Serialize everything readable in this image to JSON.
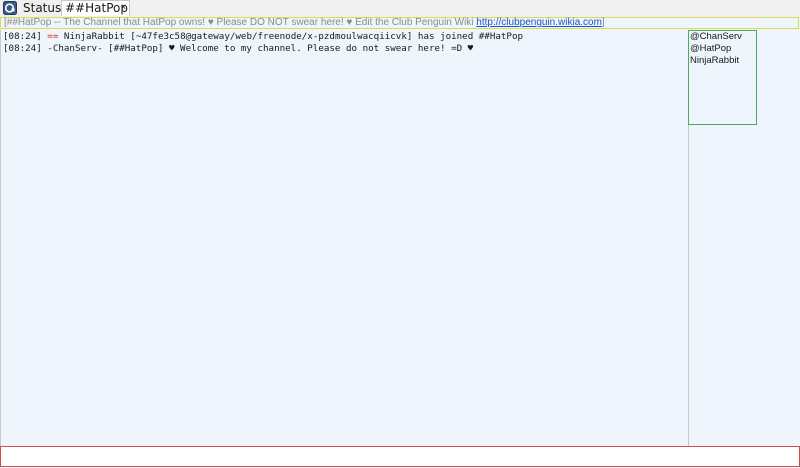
{
  "tabs": {
    "status_label": "Status",
    "channel_label": "##HatPop",
    "close_glyph": "x"
  },
  "topic": {
    "text": "[##HatPop -- The Channel that HatPop owns! ♥ Please DO NOT swear here! ♥ Edit the Club Penguin Wiki ",
    "link": "http://clubpenguin.wikia.com",
    "close_bracket": "]"
  },
  "messages": [
    {
      "time": "[08:24]",
      "marker": "==",
      "text": "NinjaRabbit [~47fe3c58@gateway/web/freenode/x-pzdmoulwacqiicvk] has joined ##HatPop"
    },
    {
      "time": "[08:24]",
      "text": "-ChanServ- [##HatPop] ♥ Welcome to my channel. Please do not swear here! =D ♥"
    }
  ],
  "users": [
    "@ChanServ",
    "@HatPop",
    "NinjaRabbit"
  ],
  "input": {
    "value": "",
    "placeholder": ""
  },
  "colors": {
    "background": "#eef5fd",
    "topic_border": "#dcdc50",
    "userlist_border": "#4caa5a",
    "input_border": "#d84848",
    "join_marker": "#d02020",
    "link": "#1a55c8"
  },
  "icons": {
    "app": "irc-client-icon"
  }
}
